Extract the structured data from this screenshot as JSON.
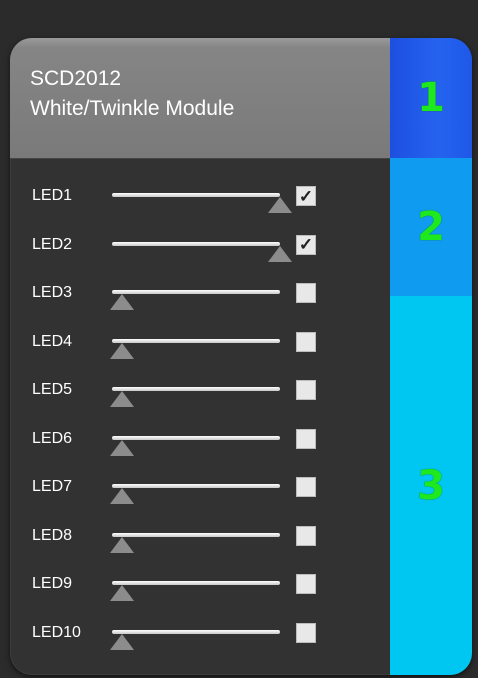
{
  "header": {
    "model": "SCD2012",
    "title": "White/Twinkle Module"
  },
  "tabs": [
    {
      "label": "1"
    },
    {
      "label": "2"
    },
    {
      "label": "3"
    }
  ],
  "leds": [
    {
      "label": "LED1",
      "level": 1.0,
      "checked": true
    },
    {
      "label": "LED2",
      "level": 1.0,
      "checked": true
    },
    {
      "label": "LED3",
      "level": 0.0,
      "checked": false
    },
    {
      "label": "LED4",
      "level": 0.0,
      "checked": false
    },
    {
      "label": "LED5",
      "level": 0.0,
      "checked": false
    },
    {
      "label": "LED6",
      "level": 0.0,
      "checked": false
    },
    {
      "label": "LED7",
      "level": 0.0,
      "checked": false
    },
    {
      "label": "LED8",
      "level": 0.0,
      "checked": false
    },
    {
      "label": "LED9",
      "level": 0.0,
      "checked": false
    },
    {
      "label": "LED10",
      "level": 0.0,
      "checked": false
    }
  ],
  "colors": {
    "tab1": "#2563ef",
    "tab2": "#0f9cf0",
    "tab3": "#00c6f2",
    "tab_text": "#1ee81e"
  }
}
